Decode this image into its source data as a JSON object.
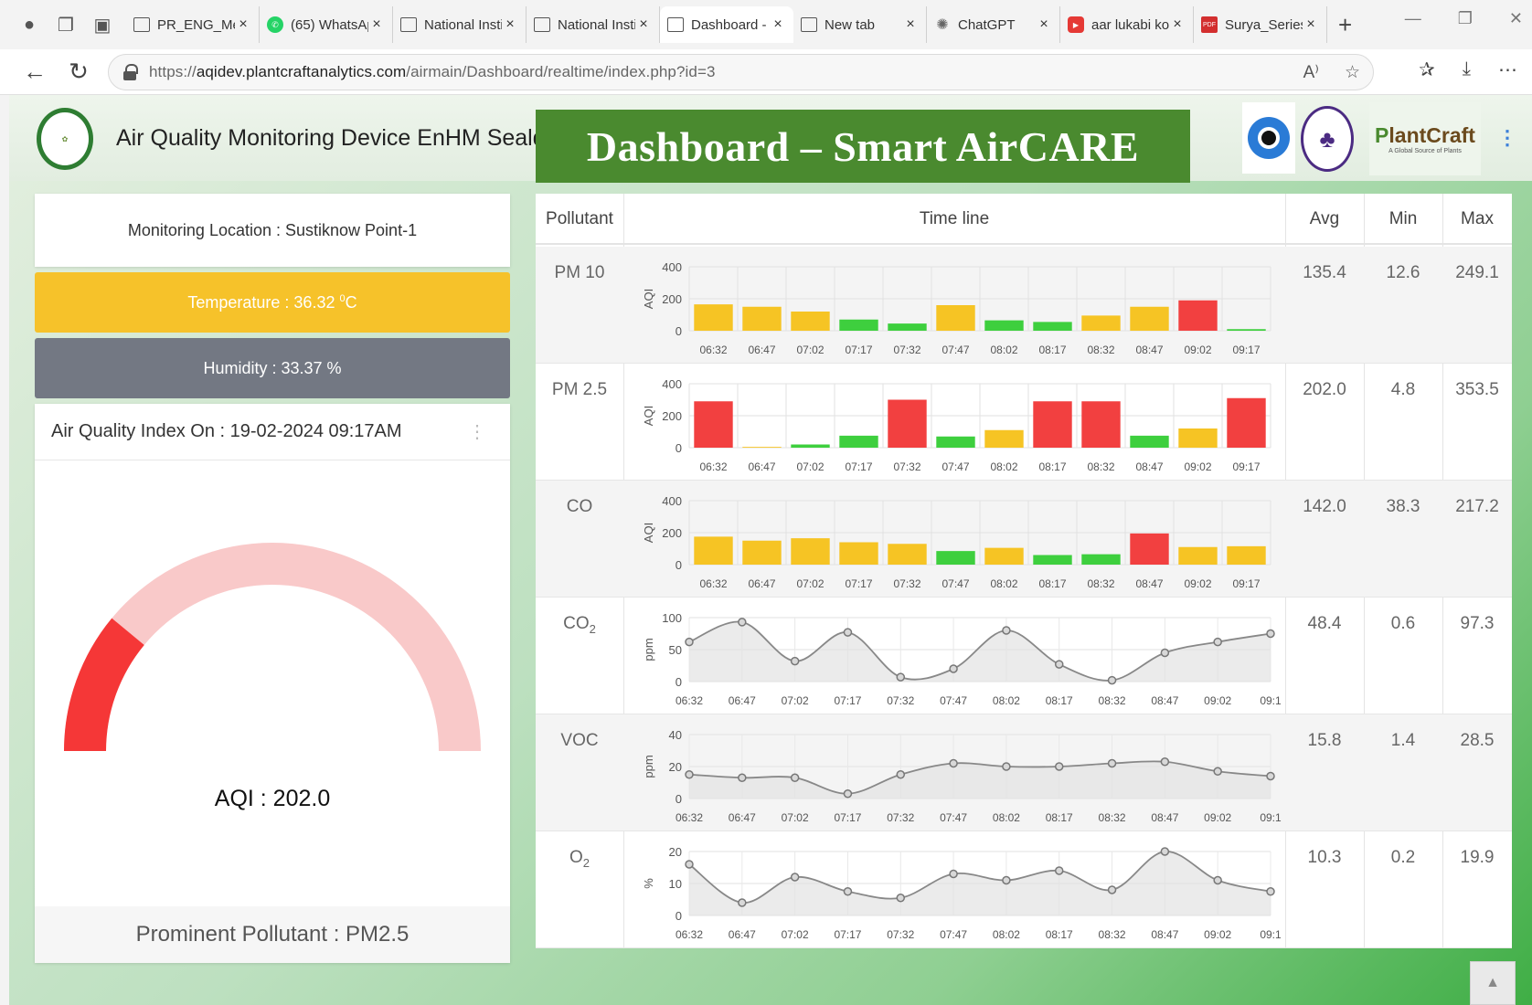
{
  "browser": {
    "tabs": [
      {
        "title": "PR_ENG_Mel",
        "favicon": "doc-icon",
        "active": false
      },
      {
        "title": "(65) WhatsAp",
        "favicon": "whatsapp-icon",
        "active": false
      },
      {
        "title": "National Insti",
        "favicon": "doc-icon",
        "active": false
      },
      {
        "title": "National Insti",
        "favicon": "doc-icon",
        "active": false
      },
      {
        "title": "Dashboard - ",
        "favicon": "doc-icon",
        "active": true
      },
      {
        "title": "New tab",
        "favicon": "newtab-icon",
        "active": false
      },
      {
        "title": "ChatGPT",
        "favicon": "chatgpt-icon",
        "active": false
      },
      {
        "title": "aar lukabi ko",
        "favicon": "youtube-icon",
        "active": false
      },
      {
        "title": "Surya_Series_",
        "favicon": "pdf-icon",
        "active": false
      }
    ],
    "url_prefix": "https://",
    "url_domain": "aqidev.plantcraftanalytics.com",
    "url_path": "/airmain/Dashboard/realtime/index.php?id=3"
  },
  "header": {
    "device_title": "Air Quality Monitoring Device EnHM Sealdah",
    "banner": "Dashboard – Smart AirCARE",
    "partner_logos": [
      "Plumule Research",
      "IIT seal",
      "PlantCraft"
    ],
    "plantcraft_name_1": "P",
    "plantcraft_name_2": "lantCraft",
    "plantcraft_tagline": "A Global Source of Plants"
  },
  "left": {
    "location": "Monitoring Location : Sustiknow Point-1",
    "temperature_label": "Temperature : 36.32 ",
    "temperature_unit_sup": "0",
    "temperature_unit": "C",
    "humidity": "Humidity : 33.37 %",
    "aqi_heading": "Air Quality Index On : 19-02-2024 09:17AM",
    "aqi_value": "AQI : 202.0",
    "aqi_fraction": 0.22,
    "prominent": "Prominent Pollutant : PM2.5"
  },
  "colors": {
    "good": "#3ecf3e",
    "moderate": "#f6c424",
    "poor": "#f24040",
    "gauge_fill": "#f53737",
    "gauge_bg": "#f9c9c9",
    "line": "#888888",
    "area": "#e3e3e3"
  },
  "table": {
    "headers": {
      "pollutant": "Pollutant",
      "timeline": "Time line",
      "avg": "Avg",
      "min": "Min",
      "max": "Max"
    }
  },
  "chart_data": [
    {
      "pollutant": "PM 10",
      "sub": "",
      "type": "bar",
      "ylabel": "AQI",
      "ylim": [
        0,
        400
      ],
      "yticks": [
        0,
        200,
        400
      ],
      "categories": [
        "06:32",
        "06:47",
        "07:02",
        "07:17",
        "07:32",
        "07:47",
        "08:02",
        "08:17",
        "08:32",
        "08:47",
        "09:02",
        "09:17"
      ],
      "values": [
        165,
        150,
        120,
        70,
        45,
        160,
        65,
        55,
        95,
        150,
        190,
        10
      ],
      "levels": [
        "moderate",
        "moderate",
        "moderate",
        "good",
        "good",
        "moderate",
        "good",
        "good",
        "moderate",
        "moderate",
        "poor",
        "good"
      ],
      "avg": "135.4",
      "min": "12.6",
      "max": "249.1"
    },
    {
      "pollutant": "PM 2.5",
      "sub": "",
      "type": "bar",
      "ylabel": "AQI",
      "ylim": [
        0,
        400
      ],
      "yticks": [
        0,
        200,
        400
      ],
      "categories": [
        "06:32",
        "06:47",
        "07:02",
        "07:17",
        "07:32",
        "07:47",
        "08:02",
        "08:17",
        "08:32",
        "08:47",
        "09:02",
        "09:17"
      ],
      "values": [
        290,
        5,
        20,
        75,
        300,
        70,
        110,
        290,
        290,
        75,
        120,
        310
      ],
      "levels": [
        "poor",
        "moderate",
        "good",
        "good",
        "poor",
        "good",
        "moderate",
        "poor",
        "poor",
        "good",
        "moderate",
        "poor"
      ],
      "avg": "202.0",
      "min": "4.8",
      "max": "353.5"
    },
    {
      "pollutant": "CO",
      "sub": "",
      "type": "bar",
      "ylabel": "AQI",
      "ylim": [
        0,
        400
      ],
      "yticks": [
        0,
        200,
        400
      ],
      "categories": [
        "06:32",
        "06:47",
        "07:02",
        "07:17",
        "07:32",
        "07:47",
        "08:02",
        "08:17",
        "08:32",
        "08:47",
        "09:02",
        "09:17"
      ],
      "values": [
        175,
        150,
        165,
        140,
        130,
        85,
        105,
        60,
        65,
        195,
        110,
        115
      ],
      "levels": [
        "moderate",
        "moderate",
        "moderate",
        "moderate",
        "moderate",
        "good",
        "moderate",
        "good",
        "good",
        "poor",
        "moderate",
        "moderate"
      ],
      "avg": "142.0",
      "min": "38.3",
      "max": "217.2"
    },
    {
      "pollutant": "CO",
      "sub": "2",
      "type": "line",
      "ylabel": "ppm",
      "ylim": [
        0,
        100
      ],
      "yticks": [
        0,
        50,
        100
      ],
      "categories": [
        "06:32",
        "06:47",
        "07:02",
        "07:17",
        "07:32",
        "07:47",
        "08:02",
        "08:17",
        "08:32",
        "08:47",
        "09:02",
        "09:1"
      ],
      "values": [
        62,
        93,
        32,
        77,
        7,
        20,
        80,
        27,
        2,
        45,
        62,
        75
      ],
      "avg": "48.4",
      "min": "0.6",
      "max": "97.3"
    },
    {
      "pollutant": "VOC",
      "sub": "",
      "type": "line",
      "ylabel": "ppm",
      "ylim": [
        0,
        40
      ],
      "yticks": [
        0,
        20,
        40
      ],
      "categories": [
        "06:32",
        "06:47",
        "07:02",
        "07:17",
        "07:32",
        "07:47",
        "08:02",
        "08:17",
        "08:32",
        "08:47",
        "09:02",
        "09:1"
      ],
      "values": [
        15,
        13,
        13,
        3,
        15,
        22,
        20,
        20,
        22,
        23,
        17,
        14
      ],
      "avg": "15.8",
      "min": "1.4",
      "max": "28.5"
    },
    {
      "pollutant": "O",
      "sub": "2",
      "type": "line",
      "ylabel": "%",
      "ylim": [
        0,
        20
      ],
      "yticks": [
        0,
        10,
        20
      ],
      "categories": [
        "06:32",
        "06:47",
        "07:02",
        "07:17",
        "07:32",
        "07:47",
        "08:02",
        "08:17",
        "08:32",
        "08:47",
        "09:02",
        "09:1"
      ],
      "values": [
        16,
        4,
        12,
        7.5,
        5.5,
        13,
        11,
        14,
        8,
        20,
        11,
        7.5
      ],
      "avg": "10.3",
      "min": "0.2",
      "max": "19.9"
    }
  ]
}
